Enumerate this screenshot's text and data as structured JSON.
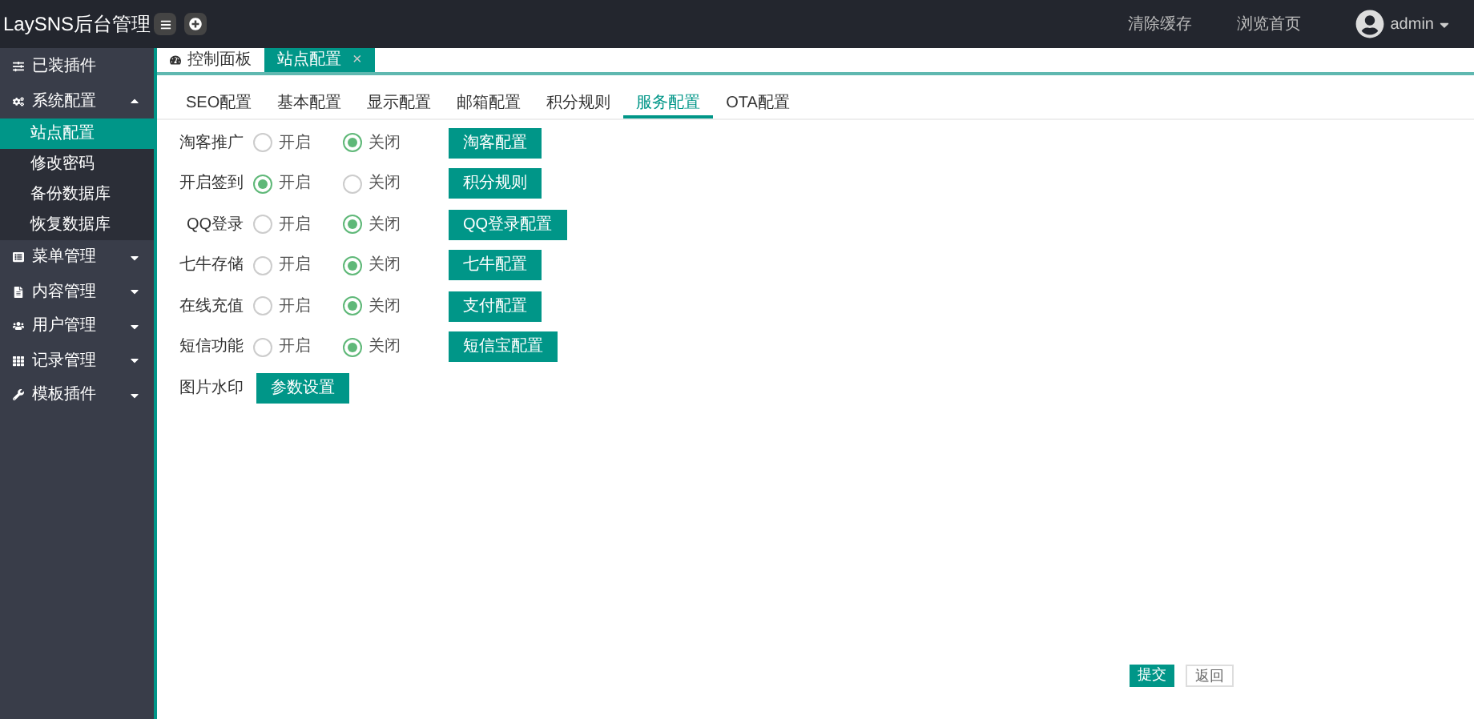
{
  "header": {
    "title": "LaySNS后台管理",
    "links": [
      "清除缓存",
      "浏览首页"
    ],
    "user": "admin"
  },
  "sidebar": {
    "items": [
      {
        "label": "已装插件",
        "kind": "link"
      },
      {
        "label": "系统配置",
        "kind": "menu",
        "expanded": true,
        "children": [
          {
            "label": "站点配置",
            "selected": true
          },
          {
            "label": "修改密码",
            "selected": false
          },
          {
            "label": "备份数据库",
            "selected": false
          },
          {
            "label": "恢复数据库",
            "selected": false
          }
        ]
      },
      {
        "label": "菜单管理",
        "kind": "menu",
        "expanded": false
      },
      {
        "label": "内容管理",
        "kind": "menu",
        "expanded": false
      },
      {
        "label": "用户管理",
        "kind": "menu",
        "expanded": false
      },
      {
        "label": "记录管理",
        "kind": "menu",
        "expanded": false
      },
      {
        "label": "模板插件",
        "kind": "menu",
        "expanded": false
      }
    ]
  },
  "page_tabs": [
    {
      "label": "控制面板",
      "selected": false
    },
    {
      "label": "站点配置",
      "selected": true,
      "close": "×"
    }
  ],
  "sub_tabs": [
    {
      "label": "SEO配置",
      "selected": false
    },
    {
      "label": "基本配置",
      "selected": false
    },
    {
      "label": "显示配置",
      "selected": false
    },
    {
      "label": "邮箱配置",
      "selected": false
    },
    {
      "label": "积分规则",
      "selected": false
    },
    {
      "label": "服务配置",
      "selected": true
    },
    {
      "label": "OTA配置",
      "selected": false
    }
  ],
  "rows": [
    {
      "kind": "toggle",
      "label": "淘客推广",
      "options": [
        {
          "label": "开启",
          "selected": false
        },
        {
          "label": "关闭",
          "selected": true
        }
      ],
      "button": "淘客配置"
    },
    {
      "kind": "toggle",
      "label": "开启签到",
      "options": [
        {
          "label": "开启",
          "selected": true
        },
        {
          "label": "关闭",
          "selected": false
        }
      ],
      "button": "积分规则"
    },
    {
      "kind": "toggle",
      "label": "QQ登录",
      "options": [
        {
          "label": "开启",
          "selected": false
        },
        {
          "label": "关闭",
          "selected": true
        }
      ],
      "button": "QQ登录配置"
    },
    {
      "kind": "toggle",
      "label": "七牛存储",
      "options": [
        {
          "label": "开启",
          "selected": false
        },
        {
          "label": "关闭",
          "selected": true
        }
      ],
      "button": "七牛配置"
    },
    {
      "kind": "toggle",
      "label": "在线充值",
      "options": [
        {
          "label": "开启",
          "selected": false
        },
        {
          "label": "关闭",
          "selected": true
        }
      ],
      "button": "支付配置"
    },
    {
      "kind": "toggle",
      "label": "短信功能",
      "options": [
        {
          "label": "开启",
          "selected": false
        },
        {
          "label": "关闭",
          "selected": true
        }
      ],
      "button": "短信宝配置"
    },
    {
      "kind": "button",
      "label": "图片水印",
      "button": "参数设置"
    }
  ],
  "footer_buttons": [
    {
      "label": "提交",
      "kind": "primary"
    },
    {
      "label": "返回",
      "kind": "default"
    }
  ]
}
